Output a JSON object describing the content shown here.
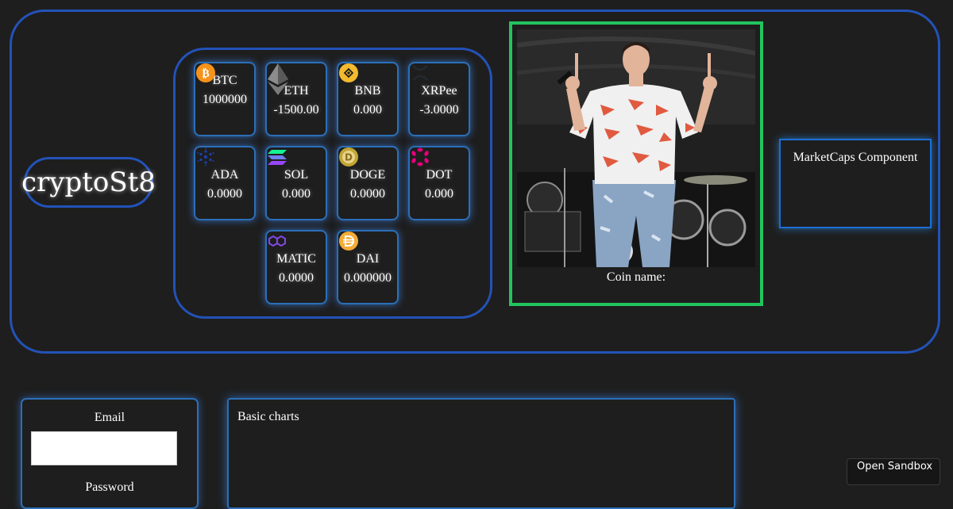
{
  "logo": {
    "text": "cryptoSt8"
  },
  "coins": [
    {
      "symbol": "BTC",
      "value": "1000000",
      "icon": "bitcoin-icon",
      "color": "#f7931a"
    },
    {
      "symbol": "ETH",
      "value": "-1500.00",
      "icon": "ethereum-icon",
      "color": "#8c8c8c"
    },
    {
      "symbol": "BNB",
      "value": "0.000",
      "icon": "bnb-icon",
      "color": "#f3ba2f"
    },
    {
      "symbol": "XRPee",
      "value": "-3.0000",
      "icon": "xrp-icon",
      "color": "#23292f"
    },
    {
      "symbol": "ADA",
      "value": "0.0000",
      "icon": "cardano-icon",
      "color": "#0033ad"
    },
    {
      "symbol": "SOL",
      "value": "0.000",
      "icon": "solana-icon",
      "color": "#9945ff"
    },
    {
      "symbol": "DOGE",
      "value": "0.0000",
      "icon": "dogecoin-icon",
      "color": "#c2a633"
    },
    {
      "symbol": "DOT",
      "value": "0.000",
      "icon": "polkadot-icon",
      "color": "#e6007a"
    },
    {
      "symbol": "MATIC",
      "value": "0.0000",
      "icon": "polygon-icon",
      "color": "#8247e5"
    },
    {
      "symbol": "DAI",
      "value": "0.000000",
      "icon": "dai-icon",
      "color": "#f5ac37"
    }
  ],
  "feature": {
    "coin_name_label": "Coin name:"
  },
  "marketcaps": {
    "title": "MarketCaps Component"
  },
  "login": {
    "email_label": "Email",
    "email_value": "",
    "password_label": "Password"
  },
  "charts": {
    "title": "Basic charts"
  },
  "sandbox": {
    "label": "Open Sandbox"
  },
  "colors": {
    "accent_border": "#2352b8",
    "photo_border": "#22c55e",
    "background": "#1e1e1e"
  }
}
